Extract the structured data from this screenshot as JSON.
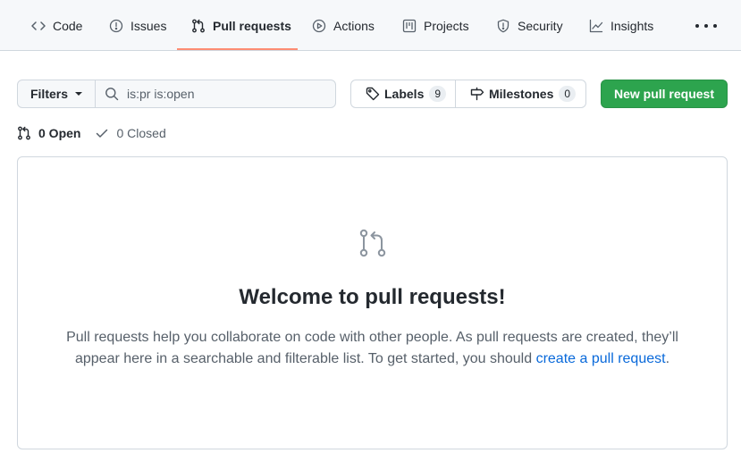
{
  "repo_nav": {
    "tabs": [
      {
        "label": "Code",
        "icon": "code-icon"
      },
      {
        "label": "Issues",
        "icon": "issue-opened-icon"
      },
      {
        "label": "Pull requests",
        "icon": "git-pull-request-icon",
        "active": true
      },
      {
        "label": "Actions",
        "icon": "play-icon"
      },
      {
        "label": "Projects",
        "icon": "project-icon"
      },
      {
        "label": "Security",
        "icon": "shield-icon"
      },
      {
        "label": "Insights",
        "icon": "graph-icon"
      }
    ],
    "more_icon": "kebab-horizontal-icon",
    "active_underline_color": "#fd8c73"
  },
  "toolbar": {
    "filters_label": "Filters",
    "search_value": "is:pr is:open",
    "labels_label": "Labels",
    "labels_count": "9",
    "milestones_label": "Milestones",
    "milestones_count": "0",
    "new_pr_label": "New pull request",
    "new_pr_color": "#2da44e"
  },
  "states": {
    "open_label": "0 Open",
    "closed_label": "0 Closed"
  },
  "blankslate": {
    "icon": "git-pull-request-icon",
    "title": "Welcome to pull requests!",
    "text": "Pull requests help you collaborate on code with other people. As pull requests are created, they’ll appear here in a searchable and filterable list. To get started, you should",
    "link_text": "create a pull request",
    "link_color": "#0969da"
  }
}
